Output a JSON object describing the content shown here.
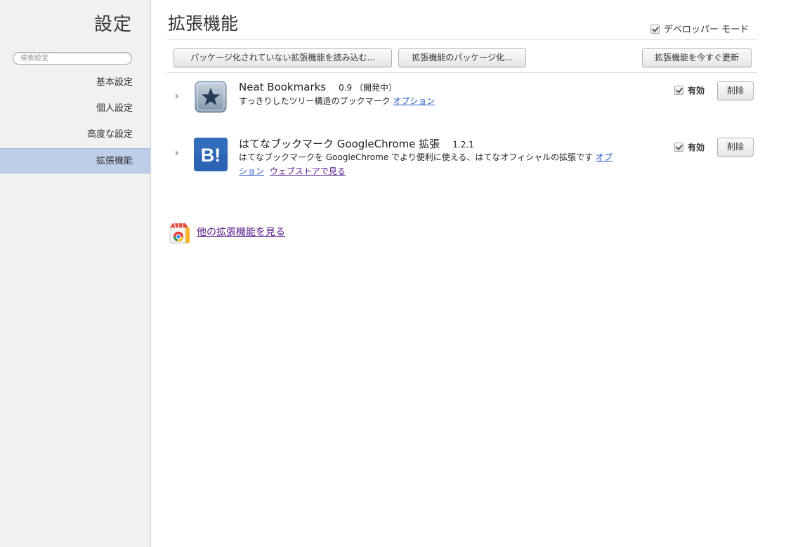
{
  "sidebar": {
    "title": "設定",
    "search_placeholder": "検索設定",
    "items": [
      {
        "label": "基本設定"
      },
      {
        "label": "個人設定"
      },
      {
        "label": "高度な設定"
      },
      {
        "label": "拡張機能",
        "selected": true
      }
    ]
  },
  "main": {
    "title": "拡張機能",
    "developer_mode": {
      "label": "デベロッパー モード",
      "checked": true
    },
    "toolbar": {
      "load_unpacked": "パッケージ化されていない拡張機能を読み込む...",
      "pack": "拡張機能のパッケージ化...",
      "update_now": "拡張機能を今すぐ更新"
    },
    "extensions": [
      {
        "name": "Neat Bookmarks",
        "version": "0.9 （開発中）",
        "description": "すっきりしたツリー構造のブックマーク",
        "links": [
          "オプション"
        ],
        "enabled_label": "有効",
        "enabled": true,
        "remove_label": "削除",
        "icon": "star-icon"
      },
      {
        "name": "はてなブックマーク GoogleChrome 拡張",
        "version": "1.2.1",
        "description": "はてなブックマークを GoogleChrome でより便利に使える、はてなオフィシャルの拡張です",
        "links": [
          "オプション",
          "ウェブストアで見る"
        ],
        "enabled_label": "有効",
        "enabled": true,
        "remove_label": "削除",
        "icon": "hatena-b-icon",
        "icon_text": "B!"
      }
    ],
    "gallery_link": "他の拡張機能を見る"
  },
  "colors": {
    "sidebar_bg": "#f1f1f1",
    "selected_bg": "#bccee8",
    "link": "#1f58c4",
    "visited_link": "#551a8b",
    "hatena_blue": "#2b64b4"
  }
}
